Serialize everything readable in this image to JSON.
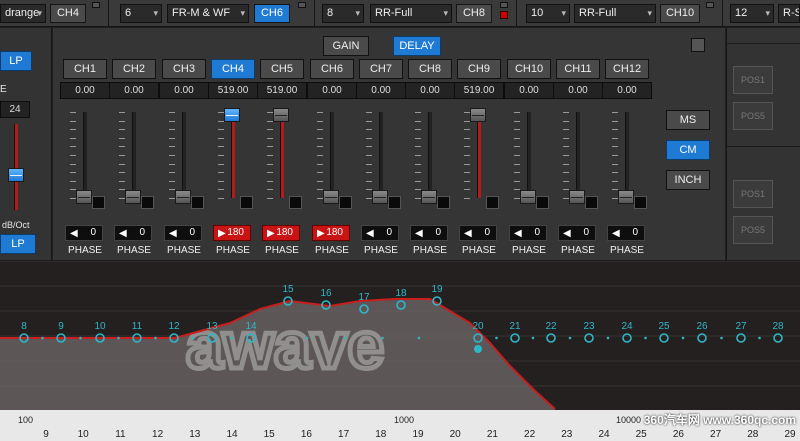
{
  "topbar": {
    "items": [
      {
        "id": "t0",
        "kind": "dd",
        "text": "drange"
      },
      {
        "id": "t1",
        "kind": "ch",
        "text": "CH4"
      },
      {
        "id": "t2",
        "kind": "dd",
        "text": "6"
      },
      {
        "id": "t3",
        "kind": "dd",
        "text": "FR-M & WF"
      },
      {
        "id": "t4",
        "kind": "ch",
        "text": "CH6",
        "on": true
      },
      {
        "id": "t5",
        "kind": "dd",
        "text": "8"
      },
      {
        "id": "t6",
        "kind": "dd",
        "text": "RR-Full"
      },
      {
        "id": "t7",
        "kind": "ch",
        "text": "CH8"
      },
      {
        "id": "t8",
        "kind": "dd",
        "text": "10"
      },
      {
        "id": "t9",
        "kind": "dd",
        "text": "RR-Full"
      },
      {
        "id": "t10",
        "kind": "ch",
        "text": "CH10"
      },
      {
        "id": "t11",
        "kind": "dd",
        "text": "12"
      },
      {
        "id": "t12",
        "kind": "dd",
        "text": "R-S"
      }
    ]
  },
  "left": {
    "lp_top": "LP",
    "e_label": "E",
    "slope_value": "24",
    "slope_unit": "dB/Oct",
    "lp_bottom": "LP"
  },
  "modes": {
    "gain": "GAIN",
    "delay": "DELAY"
  },
  "channels": [
    {
      "label": "CH1",
      "value": "0.00",
      "phase": "0",
      "inverted": false,
      "level": 0.0
    },
    {
      "label": "CH2",
      "value": "0.00",
      "phase": "0",
      "inverted": false,
      "level": 0.0
    },
    {
      "label": "CH3",
      "value": "0.00",
      "phase": "0",
      "inverted": false,
      "level": 0.0
    },
    {
      "label": "CH4",
      "value": "519.00",
      "phase": "180",
      "inverted": true,
      "level": 1.0,
      "selected": true
    },
    {
      "label": "CH5",
      "value": "519.00",
      "phase": "180",
      "inverted": true,
      "level": 1.0
    },
    {
      "label": "CH6",
      "value": "0.00",
      "phase": "180",
      "inverted": true,
      "level": 0.0
    },
    {
      "label": "CH7",
      "value": "0.00",
      "phase": "0",
      "inverted": false,
      "level": 0.0
    },
    {
      "label": "CH8",
      "value": "0.00",
      "phase": "0",
      "inverted": false,
      "level": 0.0
    },
    {
      "label": "CH9",
      "value": "519.00",
      "phase": "0",
      "inverted": false,
      "level": 1.0
    },
    {
      "label": "CH10",
      "value": "0.00",
      "phase": "0",
      "inverted": false,
      "level": 0.0
    },
    {
      "label": "CH11",
      "value": "0.00",
      "phase": "0",
      "inverted": false,
      "level": 0.0
    },
    {
      "label": "CH12",
      "value": "0.00",
      "phase": "0",
      "inverted": false,
      "level": 0.0
    }
  ],
  "phase_label": "PHASE",
  "units": {
    "ms": "MS",
    "cm": "CM",
    "inch": "INCH",
    "selected": "CM"
  },
  "positions": [
    "POS1",
    "POS5",
    "POS1",
    "POS5"
  ],
  "graph": {
    "bands": [
      "8",
      "9",
      "10",
      "11",
      "12",
      "13",
      "14",
      "15",
      "16",
      "17",
      "18",
      "19",
      "20",
      "21",
      "22",
      "23",
      "24",
      "25",
      "26",
      "27",
      "28"
    ],
    "freq_labels": [
      "100",
      "1000",
      "10000"
    ],
    "axis_numbers": [
      "9",
      "10",
      "11",
      "12",
      "13",
      "14",
      "15",
      "16",
      "17",
      "18",
      "19",
      "20",
      "21",
      "22",
      "23",
      "24",
      "25",
      "26",
      "27",
      "28",
      "29"
    ],
    "watermark_logo": "awave",
    "colors": {
      "curve": "#c81e1e",
      "band": "#2fb7c8",
      "fill": "#6a6464"
    }
  },
  "watermark_site": "360汽车网 www.360qc.com"
}
